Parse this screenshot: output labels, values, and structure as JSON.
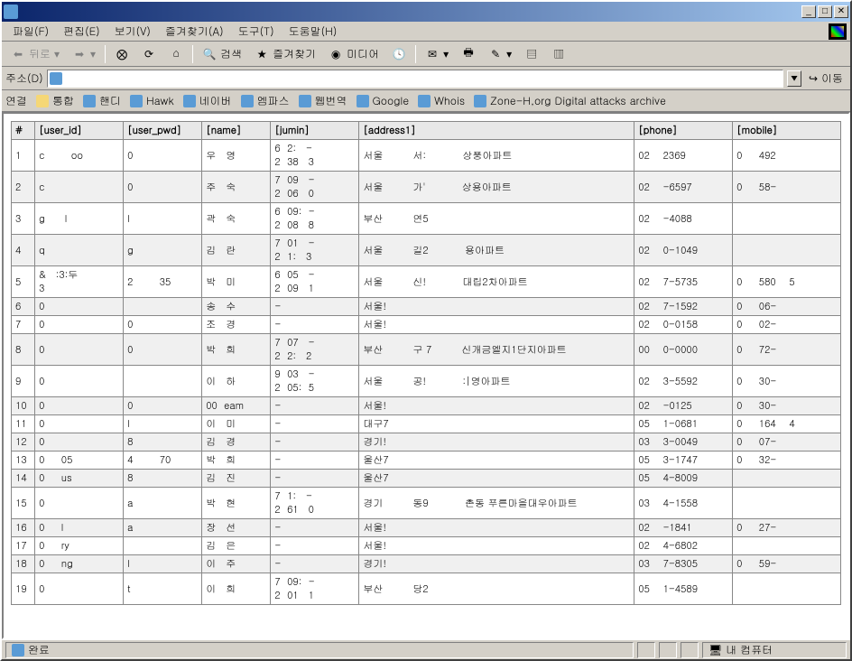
{
  "window": {
    "title": ""
  },
  "menu": {
    "file": "파일(F)",
    "edit": "편집(E)",
    "view": "보기(V)",
    "favorites": "즐겨찾기(A)",
    "tools": "도구(T)",
    "help": "도움말(H)"
  },
  "toolbar": {
    "back": "뒤로",
    "search": "검색",
    "favorites": "즐겨찾기",
    "media": "미디어"
  },
  "address": {
    "label": "주소(D)",
    "value": "",
    "go": "이동"
  },
  "links": {
    "label": "연결",
    "items": [
      "통합",
      "핸디",
      "Hawk",
      "네이버",
      "엠파스",
      "웹번역",
      "Google",
      "Whois",
      "Zone-H,org  Digital attacks archive"
    ]
  },
  "table": {
    "headers": [
      "#",
      "[user_id]",
      "[user_pwd]",
      "[name]",
      "[jumin]",
      "[address1]",
      "[phone]",
      "[mobile]"
    ],
    "rows": [
      {
        "n": "1",
        "uid": "c        oo",
        "pwd": "0",
        "name": "우   영",
        "jumin": "6  2:   -\n2  38   3",
        "addr": "서울         서:           상풍아파트",
        "phone": "02    2369",
        "mobile": "0     492"
      },
      {
        "n": "2",
        "uid": "c",
        "pwd": "0",
        "name": "주   숙",
        "jumin": "7  09   -\n2  06   0",
        "addr": "서울         가'           상용아파트",
        "phone": "02    -6597",
        "mobile": "0     58-"
      },
      {
        "n": "3",
        "uid": "g      l",
        "pwd": "l",
        "name": "곽   숙",
        "jumin": "6  09:  -\n2  08   8",
        "addr": "부산         연5",
        "phone": "02    -4088",
        "mobile": ""
      },
      {
        "n": "4",
        "uid": "q",
        "pwd": "g",
        "name": "김   란",
        "jumin": "7  01   -\n2  1:   3",
        "addr": "서울         길2           용아파트",
        "phone": "02    0-1049",
        "mobile": ""
      },
      {
        "n": "5",
        "uid": "&   :3:두\n3",
        "pwd": "2        35",
        "name": "박   미",
        "jumin": "6  05   -\n2  09   1",
        "addr": "서울         신!           대립2차아파트",
        "phone": "02    7-5735",
        "mobile": "0     580    5"
      },
      {
        "n": "6",
        "uid": "0",
        "pwd": "",
        "name": "송   수",
        "jumin": "-",
        "addr": "서울!",
        "phone": "02    7-1592",
        "mobile": "0     06-"
      },
      {
        "n": "7",
        "uid": "0",
        "pwd": "0",
        "name": "조   경",
        "jumin": "-",
        "addr": "서울!",
        "phone": "02    0-0158",
        "mobile": "0     02-"
      },
      {
        "n": "8",
        "uid": "0",
        "pwd": "0",
        "name": "박   희",
        "jumin": "7  07   -\n2  2:   2",
        "addr": "부산         구 7         신개금엘지1단지아파트",
        "phone": "00    0-0000",
        "mobile": "0     72-"
      },
      {
        "n": "9",
        "uid": "0",
        "pwd": "",
        "name": "이   하",
        "jumin": "9  03   -\n2  05:  5",
        "addr": "서울         공!           :|영아파트",
        "phone": "02    3-5592",
        "mobile": "0     30-"
      },
      {
        "n": "10",
        "uid": "0",
        "pwd": "0",
        "name": "00  eam",
        "jumin": "-",
        "addr": "서울!",
        "phone": "02    -0125",
        "mobile": "0     30-"
      },
      {
        "n": "11",
        "uid": "0",
        "pwd": "l",
        "name": "이   미",
        "jumin": "-",
        "addr": "대구7",
        "phone": "05    1-0681",
        "mobile": "0     164    4"
      },
      {
        "n": "12",
        "uid": "0",
        "pwd": "8",
        "name": "김   경",
        "jumin": "-",
        "addr": "경기!",
        "phone": "03    3-0049",
        "mobile": "0     07-"
      },
      {
        "n": "13",
        "uid": "0     05",
        "pwd": "4        70",
        "name": "박   희",
        "jumin": "-",
        "addr": "울산7",
        "phone": "05    3-1747",
        "mobile": "0     32-"
      },
      {
        "n": "14",
        "uid": "0     us",
        "pwd": "8",
        "name": "김   진",
        "jumin": "-",
        "addr": "울산7",
        "phone": "05    4-8009",
        "mobile": ""
      },
      {
        "n": "15",
        "uid": "0",
        "pwd": "a",
        "name": "박   현",
        "jumin": "7  1:   -\n2  61   0",
        "addr": "경기         동9           촌동 푸른마을대우아파트",
        "phone": "03    4-1558",
        "mobile": ""
      },
      {
        "n": "16",
        "uid": "0     l",
        "pwd": "a",
        "name": "장   선",
        "jumin": "-",
        "addr": "서울!",
        "phone": "02    -1841",
        "mobile": "0     27-"
      },
      {
        "n": "17",
        "uid": "0     ry",
        "pwd": "",
        "name": "김   은",
        "jumin": "-",
        "addr": "서울!",
        "phone": "02    4-6802",
        "mobile": ""
      },
      {
        "n": "18",
        "uid": "0     ng",
        "pwd": "l",
        "name": "이   주",
        "jumin": "-",
        "addr": "경기!",
        "phone": "03    7-8305",
        "mobile": "0     59-"
      },
      {
        "n": "19",
        "uid": "0",
        "pwd": "t",
        "name": "이   희",
        "jumin": "7  09:  -\n2  01   1",
        "addr": "부산         당2",
        "phone": "05    1-4589",
        "mobile": ""
      }
    ]
  },
  "status": {
    "done": "완료",
    "zone": "내 컴퓨터"
  }
}
